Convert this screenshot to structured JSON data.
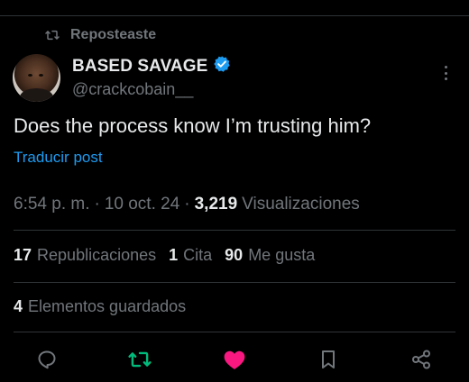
{
  "repost": {
    "label": "Reposteaste"
  },
  "author": {
    "display_name": "BASED SAVAGE",
    "handle": "@crackcobain__",
    "verified": true
  },
  "tweet": {
    "text": "Does the process know I’m trusting him?",
    "translate_label": "Traducir post"
  },
  "meta": {
    "time": "6:54 p. m.",
    "separator": "·",
    "date": "10 oct. 24",
    "views_count": "3,219",
    "views_label": "Visualizaciones"
  },
  "stats": {
    "reposts_count": "17",
    "reposts_label": "Republicaciones",
    "quotes_count": "1",
    "quotes_label": "Cita",
    "likes_count": "90",
    "likes_label": "Me gusta",
    "bookmarks_count": "4",
    "bookmarks_label": "Elementos guardados"
  },
  "actions": {
    "reply_icon": "reply-icon",
    "repost_icon": "repost-icon",
    "like_icon": "heart-icon",
    "bookmark_icon": "bookmark-icon",
    "share_icon": "share-icon"
  },
  "colors": {
    "background": "#000000",
    "text_primary": "#e7e9ea",
    "text_secondary": "#71767b",
    "link": "#1d9bf0",
    "verified": "#1d9bf0",
    "repost_active": "#00ba7c",
    "like_active": "#f91880",
    "divider": "#2f3336"
  }
}
